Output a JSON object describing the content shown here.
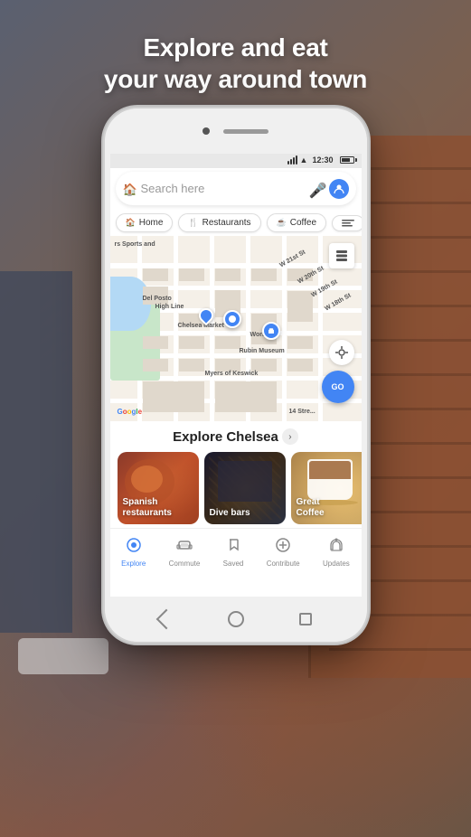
{
  "background": {
    "description": "Blurred street scene with brick buildings"
  },
  "headline": {
    "line1": "Explore and eat",
    "line2": "your way around town"
  },
  "phone": {
    "status_bar": {
      "time": "12:30",
      "signal": true,
      "wifi": true,
      "battery": true
    },
    "search": {
      "placeholder": "Search here",
      "mic_icon": "mic",
      "avatar_icon": "person"
    },
    "filter_chips": [
      {
        "id": "home",
        "icon": "🏠",
        "label": "Home"
      },
      {
        "id": "restaurants",
        "icon": "🍴",
        "label": "Restaurants"
      },
      {
        "id": "coffee",
        "icon": "☕",
        "label": "Coffee"
      },
      {
        "id": "more",
        "icon": "...",
        "label": ""
      }
    ],
    "map": {
      "location_label": "Chelsea Market",
      "work_label": "Work",
      "rubin_label": "Rubin Museum",
      "myers_label": "Myers of Keswick",
      "high_line_label": "High Line",
      "del_posto_label": "Del Posto",
      "go_button": "GO",
      "google_logo": "Google",
      "street_labels": [
        "W 18th St",
        "W 19th St",
        "W 20th St",
        "W 21st St",
        "14 Stre..."
      ],
      "top_label": "rs Sports and"
    },
    "explore": {
      "title": "Explore Chelsea",
      "arrow": ">",
      "cards": [
        {
          "id": "spanish",
          "label": "Spanish\nrestaurants"
        },
        {
          "id": "divebars",
          "label": "Dive bars"
        },
        {
          "id": "coffee",
          "label": "Great\nCoffee"
        },
        {
          "id": "fourth",
          "label": ""
        }
      ]
    },
    "bottom_nav": [
      {
        "id": "explore",
        "icon": "📍",
        "label": "Explore",
        "active": true
      },
      {
        "id": "commute",
        "icon": "🚌",
        "label": "Commute",
        "active": false
      },
      {
        "id": "saved",
        "icon": "🔖",
        "label": "Saved",
        "active": false
      },
      {
        "id": "contribute",
        "icon": "➕",
        "label": "Contribute",
        "active": false
      },
      {
        "id": "updates",
        "icon": "🔔",
        "label": "Updates",
        "active": false
      }
    ]
  }
}
